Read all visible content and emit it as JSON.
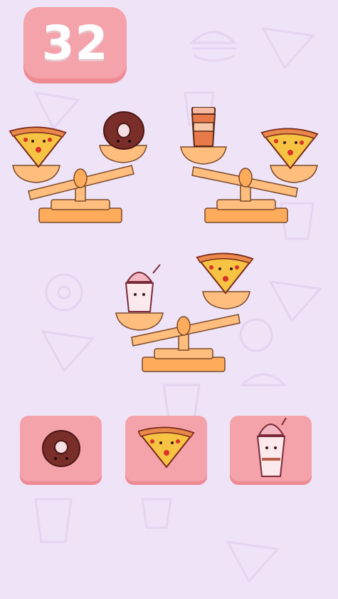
{
  "score": "32",
  "colors": {
    "background": "#efe3f7",
    "badge": "#f4a3ab",
    "badge_shadow": "#ee8a93",
    "scale_fill": "#ffb870",
    "scale_outline": "#7a4a2a"
  },
  "scales": [
    {
      "left_item": "pizza-slice-icon",
      "right_item": "donut-icon",
      "tilt": "left-down"
    },
    {
      "left_item": "coffee-cup-icon",
      "right_item": "pizza-slice-icon",
      "tilt": "right-down"
    },
    {
      "left_item": "ice-cream-sundae-icon",
      "right_item": "pizza-slice-icon",
      "tilt": "right-up"
    }
  ],
  "choices": [
    {
      "item": "donut-icon"
    },
    {
      "item": "pizza-slice-icon"
    },
    {
      "item": "ice-cream-sundae-icon"
    }
  ]
}
